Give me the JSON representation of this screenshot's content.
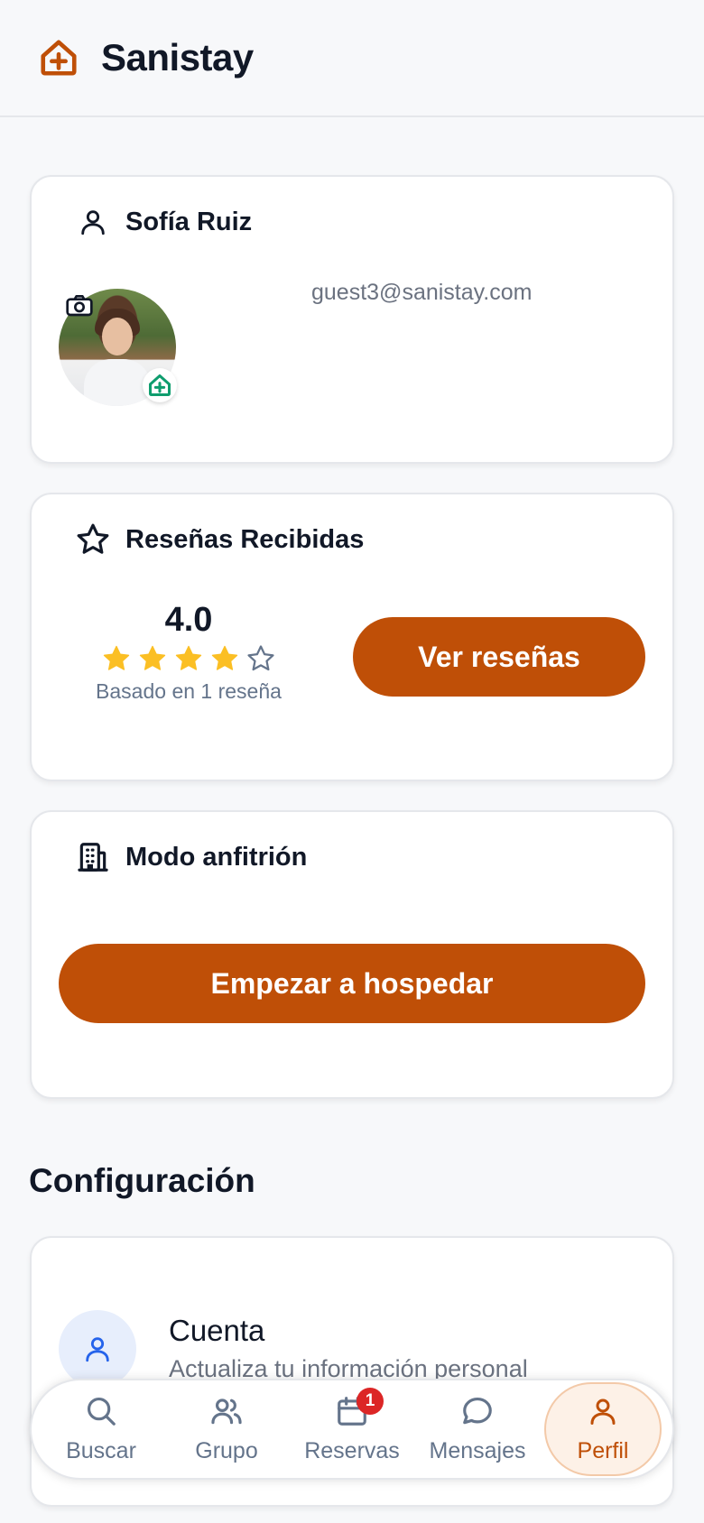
{
  "app": {
    "title": "Sanistay",
    "logo_icon": "house-plus-icon"
  },
  "profile": {
    "name": "Sofía Ruiz",
    "email": "guest3@sanistay.com",
    "icons": [
      "user-icon",
      "camera-icon",
      "house-plus-badge-icon"
    ]
  },
  "reviews": {
    "title": "Reseñas Recibidas",
    "rating": "4.0",
    "stars_filled": 4,
    "stars_total": 5,
    "based_on": "Basado en 1 reseña",
    "button_label": "Ver reseñas"
  },
  "host": {
    "title": "Modo anfitrión",
    "button_label": "Empezar a hospedar"
  },
  "settings": {
    "section_title": "Configuración",
    "account_title": "Cuenta",
    "account_subtitle": "Actualiza tu información personal"
  },
  "nav": {
    "items": [
      {
        "label": "Buscar",
        "icon": "search-icon"
      },
      {
        "label": "Grupo",
        "icon": "group-icon"
      },
      {
        "label": "Reservas",
        "icon": "calendar-icon",
        "badge": "1"
      },
      {
        "label": "Mensajes",
        "icon": "chat-icon"
      },
      {
        "label": "Perfil",
        "icon": "user-icon",
        "active": true
      }
    ]
  },
  "colors": {
    "accent": "#bf4f07",
    "star": "#fbbf24",
    "badge": "#dc2626",
    "host_green": "#0f9d6e"
  }
}
